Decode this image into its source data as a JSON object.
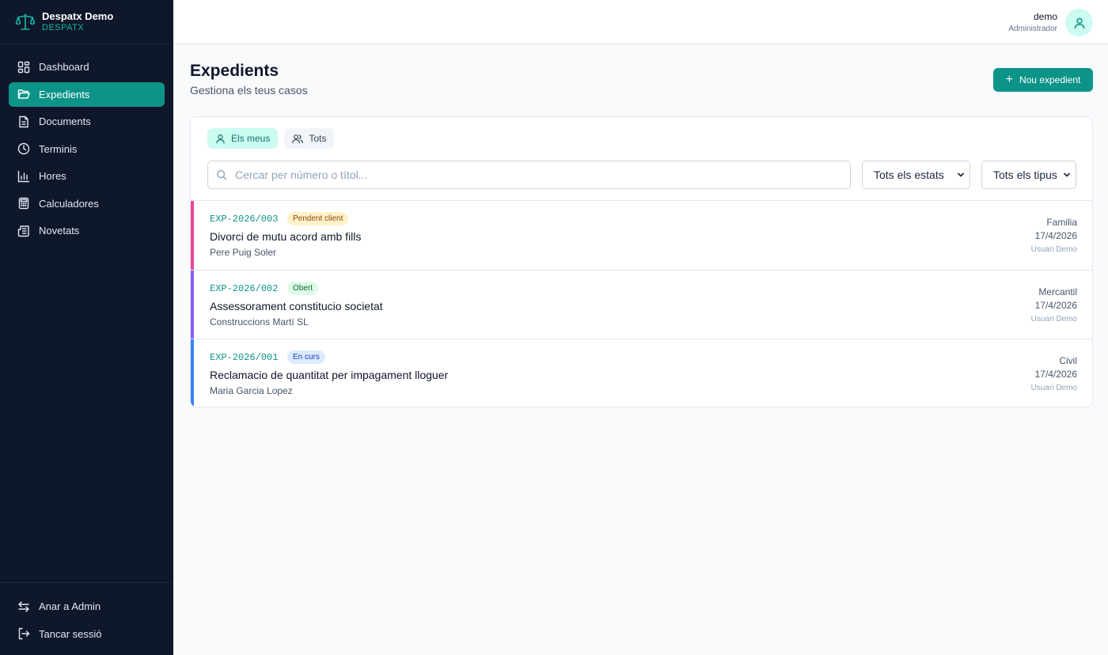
{
  "sidebar": {
    "brand_name": "Despatx Demo",
    "brand_sub": "DESPATX",
    "items": [
      {
        "label": "Dashboard",
        "icon": "dashboard-icon"
      },
      {
        "label": "Expedients",
        "icon": "folder-open-icon",
        "active": true
      },
      {
        "label": "Documents",
        "icon": "document-icon"
      },
      {
        "label": "Terminis",
        "icon": "clock-icon"
      },
      {
        "label": "Hores",
        "icon": "bar-chart-icon"
      },
      {
        "label": "Calculadores",
        "icon": "calculator-icon"
      },
      {
        "label": "Novetats",
        "icon": "newspaper-icon"
      }
    ],
    "bottom_items": [
      {
        "label": "Anar a Admin",
        "icon": "swap-icon"
      },
      {
        "label": "Tancar sessió",
        "icon": "logout-icon"
      }
    ]
  },
  "header": {
    "user_name": "demo",
    "user_role": "Administrador"
  },
  "main": {
    "title": "Expedients",
    "subtitle": "Gestiona els teus casos",
    "new_button": "Nou expedient",
    "tabs": [
      {
        "label": "Els meus",
        "active": true
      },
      {
        "label": "Tots",
        "active": false
      }
    ],
    "search_placeholder": "Cercar per número o títol...",
    "state_select": "Tots els estats",
    "type_select": "Tots els tipus",
    "cases": [
      {
        "code": "EXP-2026/003",
        "status": "Pendent client",
        "status_bg": "#fef3c7",
        "status_color": "#92400e",
        "accent": "#ec4899",
        "title": "Divorci de mutu acord amb fills",
        "client": "Pere Puig Soler",
        "type": "Familia",
        "date": "17/4/2026",
        "user": "Usuari Demo"
      },
      {
        "code": "EXP-2026/002",
        "status": "Obert",
        "status_bg": "#dcfce7",
        "status_color": "#166534",
        "accent": "#8b5cf6",
        "title": "Assessorament constitucio societat",
        "client": "Construccions Martí SL",
        "type": "Mercantil",
        "date": "17/4/2026",
        "user": "Usuari Demo"
      },
      {
        "code": "EXP-2026/001",
        "status": "En curs",
        "status_bg": "#dbeafe",
        "status_color": "#1e40af",
        "accent": "#3b82f6",
        "title": "Reclamacio de quantitat per impagament lloguer",
        "client": "Maria Garcia Lopez",
        "type": "Civil",
        "date": "17/4/2026",
        "user": "Usuari Demo"
      }
    ]
  },
  "colors": {
    "accent": "#0d9488",
    "sidebar_bg": "#0f172a"
  }
}
